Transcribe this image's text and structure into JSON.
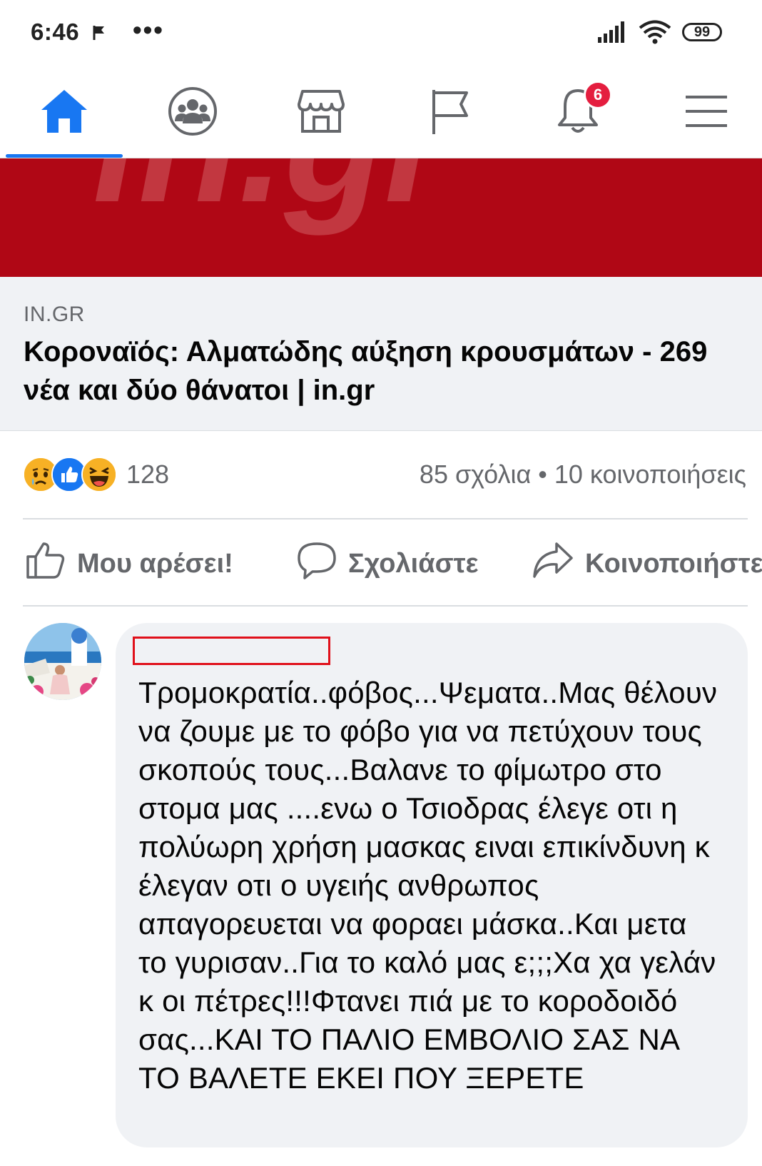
{
  "status_bar": {
    "time": "6:46",
    "overflow": "•••",
    "battery": "99",
    "icons": [
      "notification-flag-icon",
      "signal-icon",
      "wifi-icon",
      "battery-icon"
    ]
  },
  "nav": {
    "items": [
      {
        "name": "home",
        "icon": "home-icon",
        "active": true
      },
      {
        "name": "groups",
        "icon": "groups-icon",
        "active": false
      },
      {
        "name": "marketplace",
        "icon": "marketplace-icon",
        "active": false
      },
      {
        "name": "pages",
        "icon": "flag-icon",
        "active": false
      },
      {
        "name": "notifications",
        "icon": "bell-icon",
        "active": false,
        "badge": "6"
      },
      {
        "name": "menu",
        "icon": "hamburger-menu-icon",
        "active": false
      }
    ],
    "accent": "#1877f2",
    "badge_color": "#e41e3f"
  },
  "banner": {
    "watermark": "in.gr",
    "color": "#b00715"
  },
  "link_preview": {
    "domain": "IN.GR",
    "title": "Κοροναϊός: Αλματώδης αύξηση κρουσμάτων - 269 νέα και δύο θάνατοι | in.gr"
  },
  "post_meta": {
    "reaction_icons": [
      "sad-reaction-icon",
      "like-reaction-icon",
      "haha-reaction-icon"
    ],
    "reaction_count": "128",
    "comments_shares": "85 σχόλια • 10 κοινοποιήσεις"
  },
  "actions": {
    "like": "Μου αρέσει!",
    "comment": "Σχολιάστε",
    "share": "Κοινοποιήστε"
  },
  "comment": {
    "author": "",
    "text": "Τρομοκρατία..φόβος...Ψεματα..Μας θέλουν να ζουμε με το φόβο για να πετύχουν τους σκοπούς τους...Βαλανε το φίμωτρο στο στομα μας ....ενω ο Τσιοδρας έλεγε οτι η πολύωρη χρήση μασκας ειναι επικίνδυνη κ έλεγαν οτι ο υγειής ανθρωπος απαγορευεται να φοραει μάσκα..Και μετα το γυρισαν..Για το καλό μας ε;;;Χα χα γελάν κ οι πέτρες!!!Φτανει πιά με το κοροδοιδό σας...ΚΑΙ ΤΟ ΠΑΛΙΟ ΕΜΒΟΛΙΟ ΣΑΣ ΝΑ ΤΟ ΒΑΛΕΤΕ ΕΚΕΙ ΠΟΥ ΞΕΡΕΤΕ"
  }
}
